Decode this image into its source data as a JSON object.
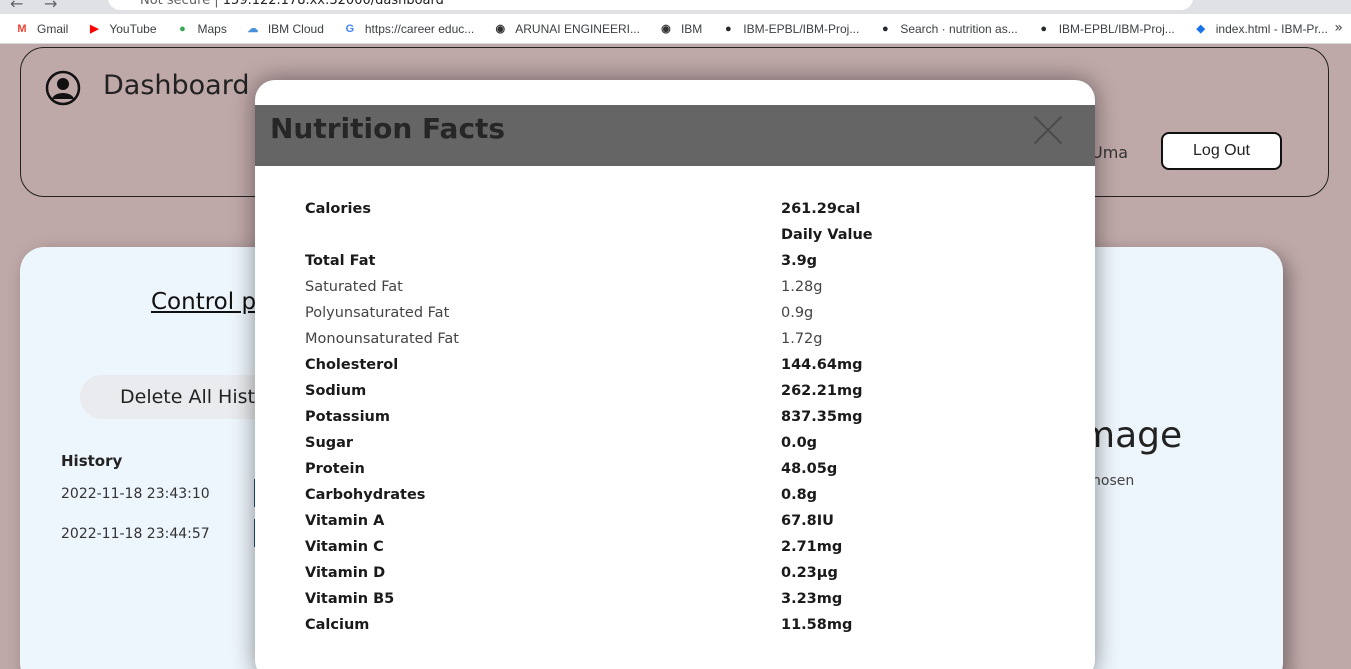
{
  "browser": {
    "address_prefix": "Not secure",
    "address_url": "159.122.178.xx:32000/dashboard",
    "bookmarks": [
      {
        "label": "Gmail",
        "icon": "gmail-icon",
        "color": "#ea4335"
      },
      {
        "label": "YouTube",
        "icon": "youtube-icon",
        "color": "#ff0000"
      },
      {
        "label": "Maps",
        "icon": "maps-icon",
        "color": "#34a853"
      },
      {
        "label": "IBM Cloud",
        "icon": "cloud-icon",
        "color": "#4a90d9"
      },
      {
        "label": "https://career educ...",
        "icon": "google-icon",
        "color": "#4285f4"
      },
      {
        "label": "ARUNAI ENGINEERI...",
        "icon": "globe-icon",
        "color": "#333333"
      },
      {
        "label": "IBM",
        "icon": "globe-icon",
        "color": "#333333"
      },
      {
        "label": "IBM-EPBL/IBM-Proj...",
        "icon": "github-icon",
        "color": "#24292e"
      },
      {
        "label": "Search · nutrition as...",
        "icon": "github-icon",
        "color": "#24292e"
      },
      {
        "label": "IBM-EPBL/IBM-Proj...",
        "icon": "github-icon",
        "color": "#24292e"
      },
      {
        "label": "index.html - IBM-Pr...",
        "icon": "vscode-icon",
        "color": "#1a73e8"
      }
    ],
    "more": "»"
  },
  "dashboard": {
    "title": "Dashboard",
    "user_name": "Uma",
    "logout_label": "Log Out"
  },
  "control_panel": {
    "title": "Control panel",
    "delete_label": "Delete All History",
    "history_title": "History",
    "history_items": [
      "2022-11-18 23:43:10",
      "2022-11-18 23:44:57"
    ],
    "image_heading": "mage",
    "chosen_text": "hosen"
  },
  "modal": {
    "title": "Nutrition Facts",
    "rows": [
      {
        "name": "Calories",
        "value": "261.29cal",
        "bold": true
      },
      {
        "name": "",
        "value": "Daily Value",
        "bold": true
      },
      {
        "name": "Total Fat",
        "value": "3.9g",
        "bold": true
      },
      {
        "name": "Saturated Fat",
        "value": "1.28g",
        "bold": false
      },
      {
        "name": "Polyunsaturated Fat",
        "value": "0.9g",
        "bold": false
      },
      {
        "name": "Monounsaturated Fat",
        "value": "1.72g",
        "bold": false
      },
      {
        "name": "Cholesterol",
        "value": "144.64mg",
        "bold": true
      },
      {
        "name": "Sodium",
        "value": "262.21mg",
        "bold": true
      },
      {
        "name": "Potassium",
        "value": "837.35mg",
        "bold": true
      },
      {
        "name": "Sugar",
        "value": "0.0g",
        "bold": true
      },
      {
        "name": "Protein",
        "value": "48.05g",
        "bold": true
      },
      {
        "name": "Carbohydrates",
        "value": "0.8g",
        "bold": true
      },
      {
        "name": "Vitamin A",
        "value": "67.8IU",
        "bold": true
      },
      {
        "name": "Vitamin C",
        "value": "2.71mg",
        "bold": true
      },
      {
        "name": "Vitamin D",
        "value": "0.23µg",
        "bold": true
      },
      {
        "name": "Vitamin B5",
        "value": "3.23mg",
        "bold": true
      },
      {
        "name": "Calcium",
        "value": "11.58mg",
        "bold": true
      }
    ]
  },
  "colors": {
    "page_bg": "#bfa8a8",
    "panel_bg": "#eef6fd",
    "modal_header": "#656565"
  }
}
